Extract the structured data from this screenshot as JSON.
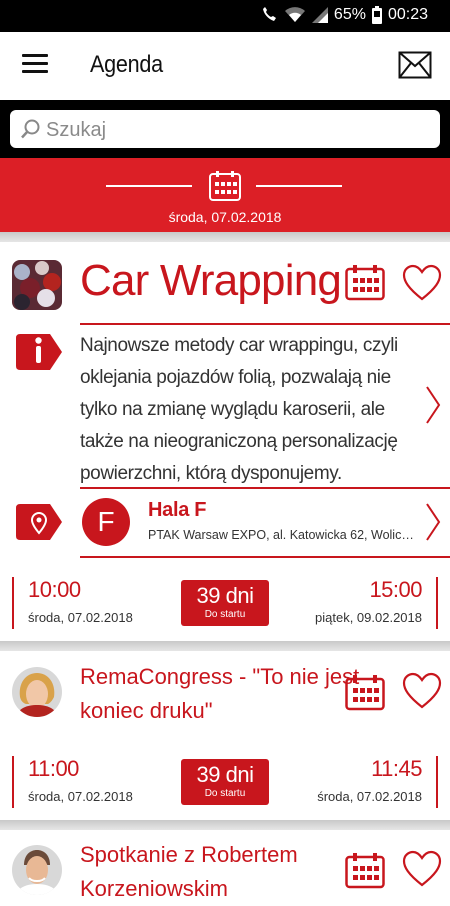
{
  "status": {
    "battery": "65%",
    "time": "00:23"
  },
  "appbar": {
    "title": "Agenda"
  },
  "search": {
    "placeholder": "Szukaj"
  },
  "date_header": {
    "date": "środa, 07.02.2018"
  },
  "events": [
    {
      "title": "Car Wrapping",
      "description": "Najnowsze metody car wrappingu, czyli oklejania pojazdów folią, pozwalają nie tylko na zmianę wyglądu karoserii, ale także na nieograniczoną personalizację powierzchni, którą dysponujemy.",
      "location": {
        "badge": "F",
        "name": "Hala F",
        "address": "PTAK Warsaw EXPO, al. Katowicka 62, Wolica 11..."
      },
      "start": {
        "time": "10:00",
        "date": "środa, 07.02.2018"
      },
      "end": {
        "time": "15:00",
        "date": "piątek, 09.02.2018"
      },
      "countdown": {
        "value": "39 dni",
        "label": "Do startu"
      }
    },
    {
      "title_line1": "RemaCongress - \"To nie jest",
      "title_line2": "koniec druku\"",
      "start": {
        "time": "11:00",
        "date": "środa, 07.02.2018"
      },
      "end": {
        "time": "11:45",
        "date": "środa, 07.02.2018"
      },
      "countdown": {
        "value": "39 dni",
        "label": "Do startu"
      }
    },
    {
      "title_line1": "Spotkanie z Robertem",
      "title_line2": "Korzeniowskim"
    }
  ],
  "colors": {
    "accent": "#dc1f26",
    "text_red": "#c8161d",
    "bar": "#000000"
  },
  "icons": [
    "phone-wifi-icon",
    "wifi-icon",
    "signal-icon",
    "battery-icon",
    "menu-icon",
    "mail-icon",
    "search-icon",
    "calendar-icon",
    "heart-icon",
    "info-icon",
    "location-pin-icon",
    "chevron-right-icon"
  ]
}
